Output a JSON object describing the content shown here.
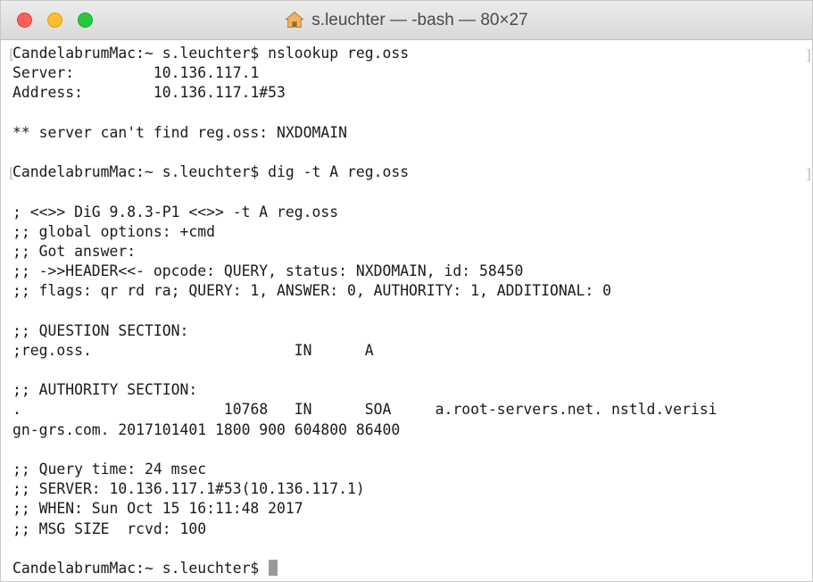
{
  "window": {
    "title": "s.leuchter — -bash — 80×27",
    "home_icon": "home-icon"
  },
  "terminal": {
    "lines": [
      {
        "text": "CandelabrumMac:~ s.leuchter$ nslookup reg.oss",
        "mark": true
      },
      {
        "text": "Server:\t\t10.136.117.1"
      },
      {
        "text": "Address:\t10.136.117.1#53"
      },
      {
        "text": ""
      },
      {
        "text": "** server can't find reg.oss: NXDOMAIN"
      },
      {
        "text": ""
      },
      {
        "text": "CandelabrumMac:~ s.leuchter$ dig -t A reg.oss",
        "mark": true
      },
      {
        "text": ""
      },
      {
        "text": "; <<>> DiG 9.8.3-P1 <<>> -t A reg.oss"
      },
      {
        "text": ";; global options: +cmd"
      },
      {
        "text": ";; Got answer:"
      },
      {
        "text": ";; ->>HEADER<<- opcode: QUERY, status: NXDOMAIN, id: 58450"
      },
      {
        "text": ";; flags: qr rd ra; QUERY: 1, ANSWER: 0, AUTHORITY: 1, ADDITIONAL: 0"
      },
      {
        "text": ""
      },
      {
        "text": ";; QUESTION SECTION:"
      },
      {
        "text": ";reg.oss.\t\t\tIN\tA"
      },
      {
        "text": ""
      },
      {
        "text": ";; AUTHORITY SECTION:"
      },
      {
        "text": ".\t\t\t10768\tIN\tSOA\ta.root-servers.net. nstld.verisi"
      },
      {
        "text": "gn-grs.com. 2017101401 1800 900 604800 86400"
      },
      {
        "text": ""
      },
      {
        "text": ";; Query time: 24 msec"
      },
      {
        "text": ";; SERVER: 10.136.117.1#53(10.136.117.1)"
      },
      {
        "text": ";; WHEN: Sun Oct 15 16:11:48 2017"
      },
      {
        "text": ";; MSG SIZE  rcvd: 100"
      },
      {
        "text": ""
      },
      {
        "text": "CandelabrumMac:~ s.leuchter$ ",
        "cursor": true
      }
    ]
  }
}
